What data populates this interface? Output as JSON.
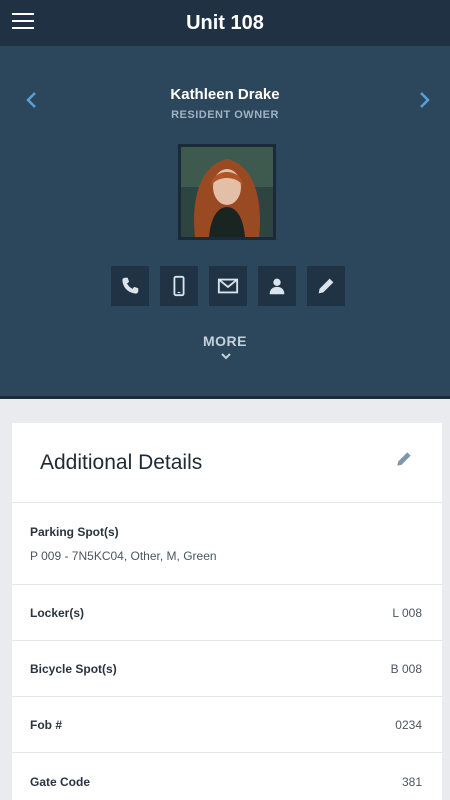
{
  "header": {
    "title": "Unit 108",
    "menu_icon": "hamburger-menu-icon"
  },
  "profile": {
    "name": "Kathleen Drake",
    "role": "RESIDENT OWNER",
    "more_label": "MORE",
    "actions": [
      {
        "icon": "phone-icon"
      },
      {
        "icon": "mobile-icon"
      },
      {
        "icon": "email-icon"
      },
      {
        "icon": "contact-icon"
      },
      {
        "icon": "edit-pencil-icon"
      }
    ]
  },
  "details": {
    "title": "Additional Details",
    "parking_label": "Parking Spot(s)",
    "parking_value": "P 009 - 7N5KC04, Other, M, Green",
    "locker_label": "Locker(s)",
    "locker_value": "L 008",
    "bicycle_label": "Bicycle Spot(s)",
    "bicycle_value": "B 008",
    "fob_label": "Fob #",
    "fob_value": "0234",
    "gate_label": "Gate Code",
    "gate_value": "381"
  },
  "colors": {
    "topbar": "#1f3142",
    "profile_bg": "#2c475c",
    "accent": "#5aa0d8",
    "action_bg": "#1f3344"
  }
}
